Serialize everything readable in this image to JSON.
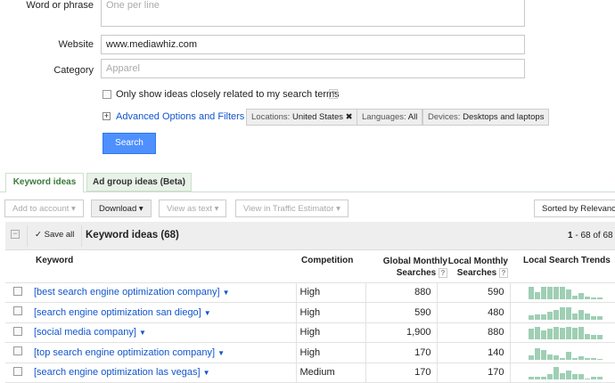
{
  "form": {
    "word_label": "Word or phrase",
    "word_placeholder": "One per line",
    "website_label": "Website",
    "website_value": "www.mediawhiz.com",
    "category_label": "Category",
    "category_placeholder": "Apparel",
    "only_related": "Only show ideas closely related to my search terms",
    "help": "?",
    "advanced": "Advanced Options and Filters",
    "chips": [
      {
        "k": "Locations:",
        "v": "United States"
      },
      {
        "k": "Languages:",
        "v": "All"
      },
      {
        "k": "Devices:",
        "v": "Desktops and laptops"
      }
    ],
    "search": "Search"
  },
  "tabs": [
    "Keyword ideas",
    "Ad group ideas (Beta)"
  ],
  "toolbar": {
    "add": "Add to account ▾",
    "download": "Download ▾",
    "view_text": "View as text ▾",
    "traffic": "View in Traffic Estimator ▾",
    "sorted": "Sorted by Relevance"
  },
  "results": {
    "save_all": "Save all",
    "title": "Keyword ideas (68)",
    "range_bold": "1",
    "range_rest": " - 68 of 68"
  },
  "columns": {
    "keyword": "Keyword",
    "competition": "Competition",
    "global1": "Global Monthly",
    "global2": "Searches",
    "local1": "Local Monthly",
    "local2": "Searches",
    "trends": "Local Search Trends",
    "help": "?"
  },
  "rows": [
    {
      "keyword": "[best search engine optimization company]",
      "competition": "High",
      "global": "880",
      "local": "590",
      "trend": [
        1,
        0.6,
        1,
        1,
        1,
        1,
        0.8,
        0.3,
        0.55,
        0.25,
        0.15,
        0.15
      ]
    },
    {
      "keyword": "[search engine optimization san diego]",
      "competition": "High",
      "global": "590",
      "local": "480",
      "trend": [
        0.35,
        0.4,
        0.4,
        0.6,
        0.8,
        1,
        1,
        0.45,
        0.8,
        0.45,
        0.3,
        0.3
      ]
    },
    {
      "keyword": "[social media company]",
      "competition": "High",
      "global": "1,900",
      "local": "880",
      "trend": [
        0.9,
        1,
        0.7,
        0.9,
        1,
        0.95,
        1,
        0.95,
        1,
        0.45,
        0.35,
        0.35
      ]
    },
    {
      "keyword": "[top search engine optimization company]",
      "competition": "High",
      "global": "170",
      "local": "140",
      "trend": [
        0.35,
        0.9,
        0.8,
        0.4,
        0.35,
        0.1,
        0.6,
        0.1,
        0.3,
        0.1,
        0.1,
        0
      ]
    },
    {
      "keyword": "[search engine optimization las vegas]",
      "competition": "Medium",
      "global": "170",
      "local": "170",
      "trend": [
        0.25,
        0.25,
        0.2,
        0.45,
        1,
        0.55,
        0.75,
        0.45,
        0.45,
        0.1,
        0.25,
        0.25
      ]
    }
  ]
}
